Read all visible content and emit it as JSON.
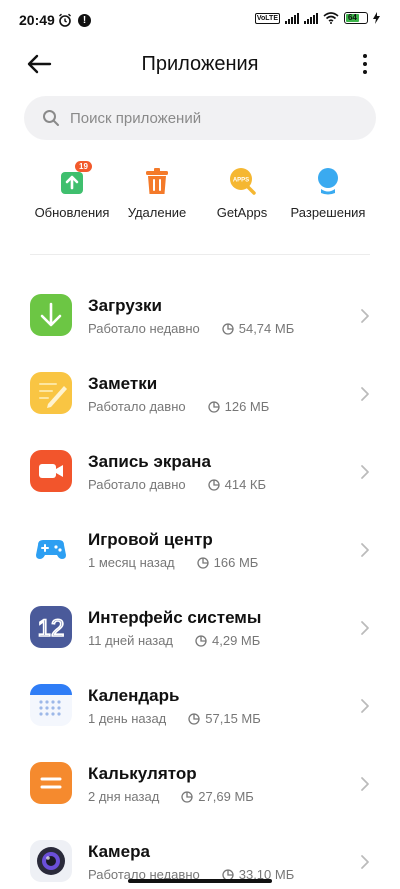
{
  "status_bar": {
    "time": "20:49",
    "notification_glyph": "!",
    "volte_label": "VoLTE",
    "battery_level": "64",
    "icons": [
      "alarm-icon",
      "notification-icon",
      "volte-icon",
      "signal-icon",
      "signal-icon",
      "wifi-icon",
      "battery-icon",
      "charging-icon"
    ]
  },
  "header": {
    "title": "Приложения",
    "back_icon": "arrow-left-icon",
    "more_icon": "more-vertical-icon"
  },
  "search": {
    "placeholder": "Поиск приложений"
  },
  "quick_actions": [
    {
      "label": "Обновления",
      "icon": "update-icon",
      "badge": "19",
      "color": "#3fbf6e"
    },
    {
      "label": "Удаление",
      "icon": "trash-icon",
      "color": "#f47a2a"
    },
    {
      "label": "GetApps",
      "icon": "getapps-icon",
      "color": "#f5b731",
      "icon_text": "APPS"
    },
    {
      "label": "Разрешения",
      "icon": "permissions-icon",
      "color": "#3aaaf0"
    }
  ],
  "apps": [
    {
      "name": "Загрузки",
      "status": "Работало недавно",
      "size": "54,74 МБ",
      "icon": "downloads-icon",
      "color": "#6cc644"
    },
    {
      "name": "Заметки",
      "status": "Работало давно",
      "size": "126 МБ",
      "icon": "notes-icon",
      "color": "#f9c543"
    },
    {
      "name": "Запись экрана",
      "status": "Работало давно",
      "size": "414 КБ",
      "icon": "screen-recorder-icon",
      "color": "#f2552c"
    },
    {
      "name": "Игровой центр",
      "status": "1 месяц назад",
      "size": "166 МБ",
      "icon": "gamepad-icon",
      "color": "#2d9ff2"
    },
    {
      "name": "Интерфейс системы",
      "status": "11 дней назад",
      "size": "4,29 МБ",
      "icon": "miui-12-icon",
      "color": "#4a5a9a",
      "icon_text": "12"
    },
    {
      "name": "Календарь",
      "status": "1 день назад",
      "size": "57,15 МБ",
      "icon": "calendar-icon",
      "color": "#2f7df6"
    },
    {
      "name": "Калькулятор",
      "status": "2 дня назад",
      "size": "27,69 МБ",
      "icon": "calculator-icon",
      "color": "#f58a2e"
    },
    {
      "name": "Камера",
      "status": "Работало недавно",
      "size": "33,10 МБ",
      "icon": "camera-icon",
      "color": "#2a2a3a"
    }
  ]
}
